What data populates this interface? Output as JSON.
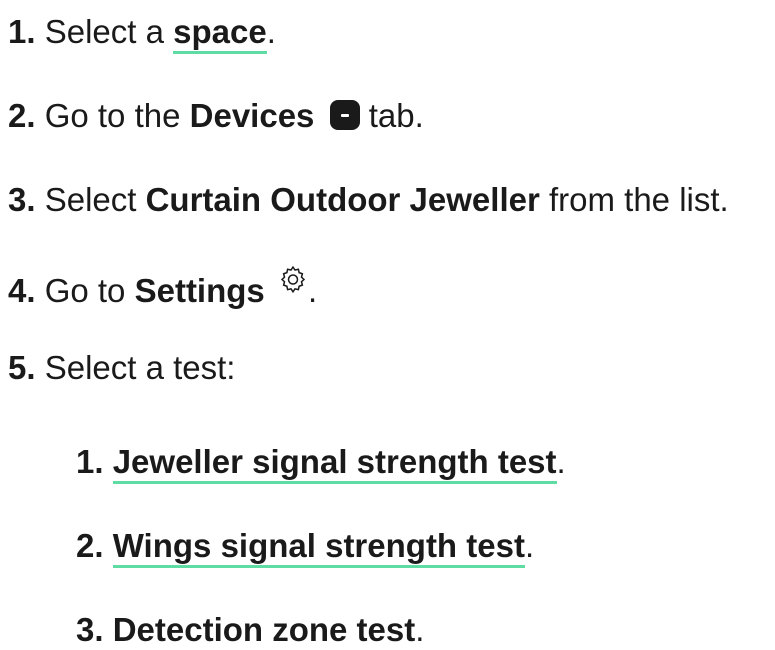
{
  "steps": [
    {
      "num": "1.",
      "pre": "Select a ",
      "link": "space",
      "post": "."
    },
    {
      "num": "2.",
      "pre": "Go to the ",
      "bold": "Devices",
      "icon": "devices-tab-icon",
      "post": " tab."
    },
    {
      "num": "3.",
      "pre": "Select ",
      "bold": "Curtain Outdoor Jeweller",
      "post": " from the list."
    },
    {
      "num": "4.",
      "pre": "Go to ",
      "bold": "Settings",
      "icon": "gear-icon",
      "post": "."
    },
    {
      "num": "5.",
      "pre": "Select a test:"
    }
  ],
  "tests": [
    {
      "num": "1.",
      "label": "Jeweller signal strength test",
      "post": ".",
      "linked": true
    },
    {
      "num": "2.",
      "label": "Wings signal strength test",
      "post": ".",
      "linked": true
    },
    {
      "num": "3.",
      "label": "Detection zone test",
      "post": ".",
      "linked": false
    }
  ],
  "colors": {
    "link_underline": "#5fdca4",
    "text": "#1a1a1a"
  }
}
